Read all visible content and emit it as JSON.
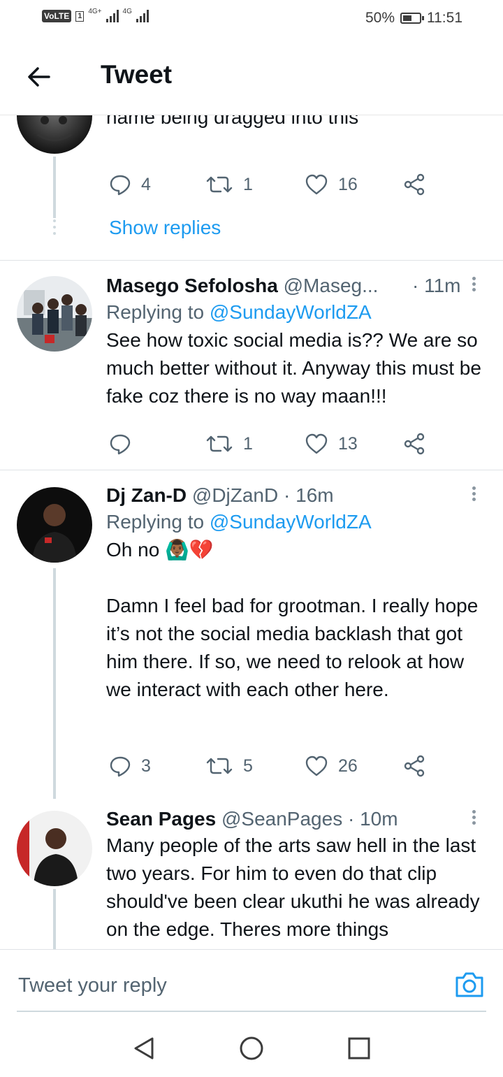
{
  "status_bar": {
    "volte": "VoLTE",
    "sim": "1",
    "net1": "4G+",
    "net2": "4G",
    "battery": "50%",
    "time": "11:51"
  },
  "header": {
    "title": "Tweet"
  },
  "tweets": [
    {
      "text": "Must be hard being Cassper 🤦 watch his name being dragged into this",
      "replies": "4",
      "retweets": "1",
      "likes": "16",
      "show_replies": "Show replies"
    },
    {
      "name": "Masego Sefolosha",
      "handle": "@Maseg...",
      "time": "· 11m",
      "replying_prefix": "Replying to",
      "replying_to": "@SundayWorldZA",
      "text": "See how toxic social media is?? We are so much better without it. Anyway this must be fake coz there is no way maan!!!",
      "replies": "",
      "retweets": "1",
      "likes": "13"
    },
    {
      "name": "Dj Zan-D",
      "handle": "@DjZanD",
      "time": "· 16m",
      "replying_prefix": "Replying to",
      "replying_to": "@SundayWorldZA",
      "text": "Oh no 🙆🏾‍♂️💔\n\nDamn I feel bad for grootman. I really hope it’s not the social media backlash that got him there. If so, we need to relook at how we interact with each other here.",
      "replies": "3",
      "retweets": "5",
      "likes": "26"
    },
    {
      "name": "Sean Pages",
      "handle": "@SeanPages",
      "time": "· 10m",
      "text": "Many people of the arts saw hell in the last two years. For him to even do that clip should've been clear ukuthi he was already on the edge. Theres more things"
    }
  ],
  "reply_bar": {
    "placeholder": "Tweet your reply"
  },
  "colors": {
    "accent": "#1d9bf0",
    "text": "#0f1419",
    "muted": "#536471",
    "thread": "#cfd9de"
  },
  "icons": [
    "back-arrow-icon",
    "reply-icon",
    "retweet-icon",
    "like-icon",
    "share-icon",
    "more-icon",
    "camera-icon",
    "nav-back-icon",
    "nav-home-icon",
    "nav-recents-icon"
  ]
}
